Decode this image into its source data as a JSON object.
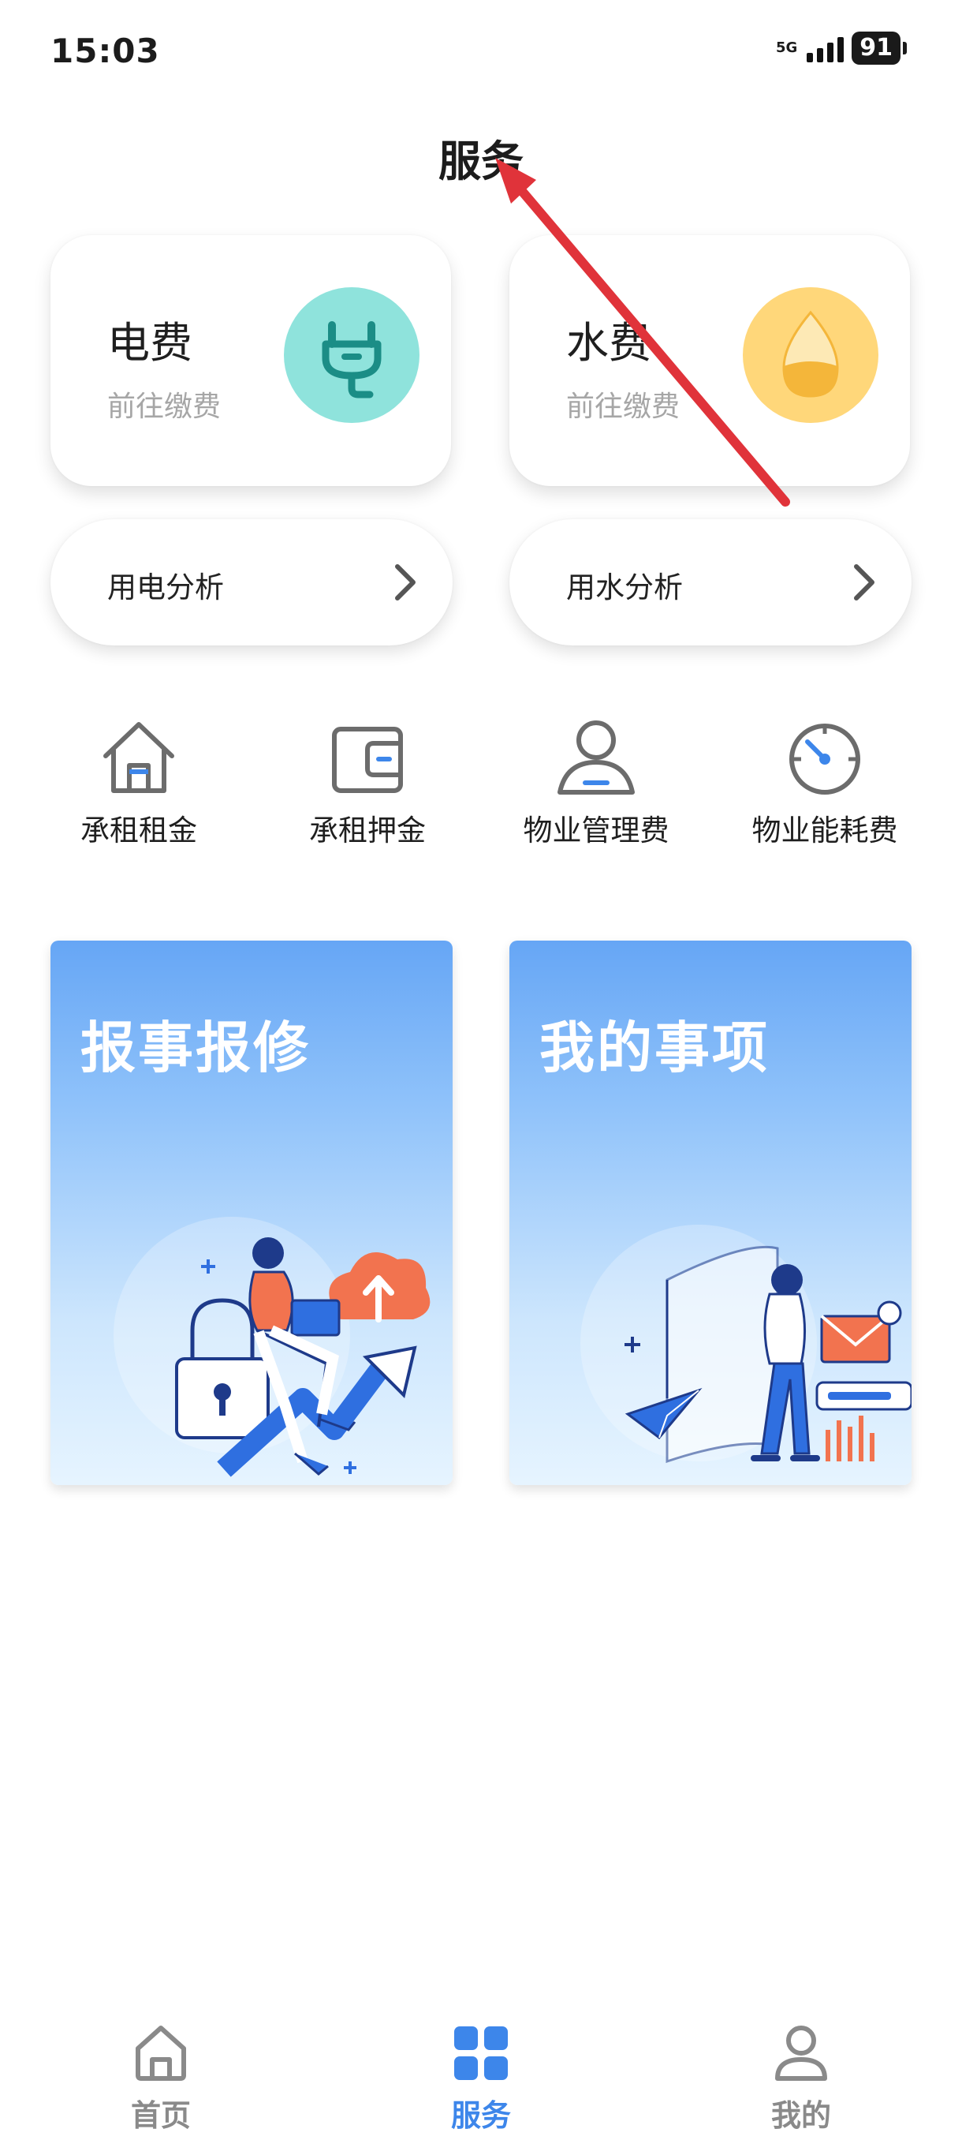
{
  "status_bar": {
    "time": "15:03",
    "network": "5G",
    "battery": "91"
  },
  "header": {
    "title": "服务"
  },
  "fee_cards": [
    {
      "title": "电费",
      "subtitle": "前往缴费",
      "icon": "plug-icon",
      "color": "#8fe3dc"
    },
    {
      "title": "水费",
      "subtitle": "前往缴费",
      "icon": "water-drop-icon",
      "color": "#ffd77a"
    }
  ],
  "analysis_links": [
    {
      "label": "用电分析",
      "icon": "chevron-right-icon"
    },
    {
      "label": "用水分析",
      "icon": "chevron-right-icon"
    }
  ],
  "quick_services": [
    {
      "label": "承租租金",
      "icon": "house-icon"
    },
    {
      "label": "承租押金",
      "icon": "wallet-icon"
    },
    {
      "label": "物业管理费",
      "icon": "person-icon"
    },
    {
      "label": "物业能耗费",
      "icon": "gauge-icon"
    }
  ],
  "banners": [
    {
      "title": "报事报修",
      "illustration": "person-with-lock-and-cloud"
    },
    {
      "title": "我的事项",
      "illustration": "person-with-mail-and-chart"
    }
  ],
  "bottom_nav": [
    {
      "label": "首页",
      "icon": "home-icon",
      "active": false
    },
    {
      "label": "服务",
      "icon": "grid-icon",
      "active": true
    },
    {
      "label": "我的",
      "icon": "user-icon",
      "active": false
    }
  ],
  "colors": {
    "accent": "#3d86ea",
    "annotation": "#e0333a"
  }
}
